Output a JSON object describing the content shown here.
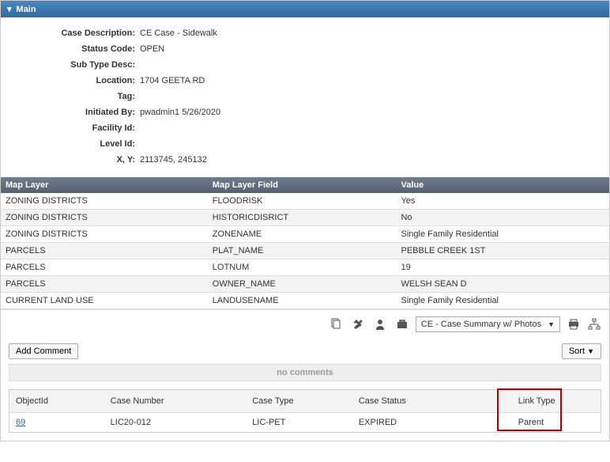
{
  "panel": {
    "title": "Main"
  },
  "details": [
    {
      "label": "Case Description:",
      "value": "CE Case - Sidewalk"
    },
    {
      "label": "Status Code:",
      "value": "OPEN"
    },
    {
      "label": "Sub Type Desc:",
      "value": ""
    },
    {
      "label": "Location:",
      "value": "1704 GEETA RD"
    },
    {
      "label": "Tag:",
      "value": ""
    },
    {
      "label": "Initiated By:",
      "value": "pwadmin1 5/26/2020"
    },
    {
      "label": "Facility Id:",
      "value": ""
    },
    {
      "label": "Level Id:",
      "value": ""
    },
    {
      "label": "X, Y:",
      "value": "2113745, 245132"
    }
  ],
  "layer_grid": {
    "headers": [
      "Map Layer",
      "Map Layer Field",
      "Value"
    ],
    "rows": [
      [
        "ZONING DISTRICTS",
        "FLOODRISK",
        "Yes"
      ],
      [
        "ZONING DISTRICTS",
        "HISTORICDISRICT",
        "No"
      ],
      [
        "ZONING DISTRICTS",
        "ZONENAME",
        "Single Family Residential"
      ],
      [
        "PARCELS",
        "PLAT_NAME",
        "PEBBLE CREEK 1ST"
      ],
      [
        "PARCELS",
        "LOTNUM",
        "19"
      ],
      [
        "PARCELS",
        "OWNER_NAME",
        "WELSH SEAN D"
      ],
      [
        "CURRENT LAND USE",
        "LANDUSENAME",
        "Single Family Residential"
      ]
    ]
  },
  "toolbar": {
    "report_select": "CE - Case Summary w/ Photos"
  },
  "comments": {
    "add_label": "Add Comment",
    "sort_label": "Sort",
    "empty": "no comments"
  },
  "linked": {
    "headers": [
      "ObjectId",
      "Case Number",
      "Case Type",
      "Case Status",
      "Link Type"
    ],
    "rows": [
      {
        "objectid": "69",
        "casenum": "LIC20-012",
        "casetype": "LIC-PET",
        "casestatus": "EXPIRED",
        "linktype": "Parent"
      }
    ]
  }
}
